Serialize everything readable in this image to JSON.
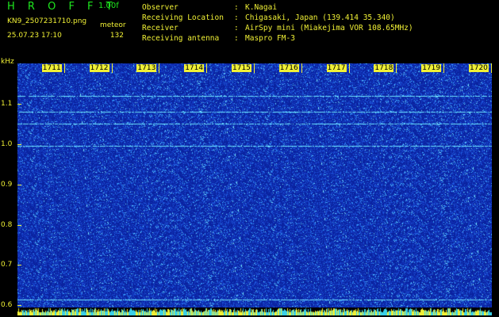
{
  "header": {
    "app_name": "HROFFT",
    "version": "1.00f",
    "filename": "KN9_2507231710.png",
    "mode": "meteor",
    "datetime": "25.07.23 17:10",
    "count": "132"
  },
  "info": [
    {
      "label": "Observer",
      "sep": ":",
      "value": "K.Nagai"
    },
    {
      "label": "Receiving Location",
      "sep": ":",
      "value": "Chigasaki, Japan (139.414 35.340)"
    },
    {
      "label": "Receiver",
      "sep": ":",
      "value": "AirSpy mini (Miakejima VOR 108.65MHz)"
    },
    {
      "label": "Receiving antenna",
      "sep": ":",
      "value": "Maspro FM-3"
    }
  ],
  "plot": {
    "y_unit": "kHz",
    "y_ticks": [
      "1.1",
      "1.0",
      "0.9",
      "0.8",
      "0.7",
      "0.6"
    ],
    "y_tick_values": [
      1.1,
      1.0,
      0.9,
      0.8,
      0.7,
      0.6
    ],
    "y_range": [
      0.575,
      1.2
    ],
    "minute_labels": [
      "1711",
      "1712",
      "1713",
      "1714",
      "1715",
      "1716",
      "1717",
      "1718",
      "1719",
      "1720"
    ],
    "minute_offsets": [
      1,
      2,
      3,
      4,
      5,
      6,
      7,
      8,
      9,
      10
    ],
    "minutes_span": 10,
    "carrier_lines_khz": [
      1.12,
      1.08,
      1.05,
      0.995,
      0.615,
      0.593
    ],
    "colors": {
      "background": "#0a2aa8",
      "noise_low": "#1e40d0",
      "noise_high": "#4ad8ff",
      "carrier": "#6ee8ff",
      "strip": "#f0f035"
    }
  }
}
